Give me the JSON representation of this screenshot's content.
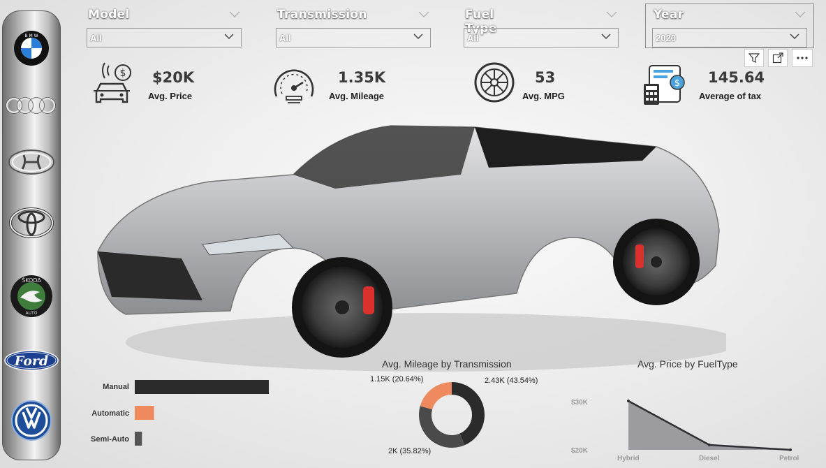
{
  "brands": [
    {
      "name": "BMW",
      "icon": "bmw-logo"
    },
    {
      "name": "Audi",
      "icon": "audi-logo"
    },
    {
      "name": "Hyundai",
      "icon": "hyundai-logo"
    },
    {
      "name": "Toyota",
      "icon": "toyota-logo"
    },
    {
      "name": "Skoda",
      "icon": "skoda-logo"
    },
    {
      "name": "Ford",
      "icon": "ford-logo"
    },
    {
      "name": "Volkswagen",
      "icon": "vw-logo"
    }
  ],
  "bmw_text": "B M W",
  "skoda_text": "ŠKODA",
  "skoda_auto": "AUTO",
  "ford_text": "Ford",
  "filters": {
    "model": {
      "title": "Model",
      "value": "All"
    },
    "transmission": {
      "title": "Transmission",
      "value": "All"
    },
    "fuel": {
      "title": "Fuel Type",
      "value": "All"
    },
    "year": {
      "title": "Year",
      "value": "2020"
    }
  },
  "kpis": {
    "price": {
      "value": "$20K",
      "label": "Avg. Price",
      "icon": "car-price-icon"
    },
    "mileage": {
      "value": "1.35K",
      "label": "Avg. Mileage",
      "icon": "speedometer-icon"
    },
    "mpg": {
      "value": "53",
      "label": "Avg. MPG",
      "icon": "tire-icon"
    },
    "tax": {
      "value": "145.64",
      "label": "Average of tax",
      "icon": "tax-calculator-icon"
    }
  },
  "toolbar": [
    "filter-icon",
    "focus-mode-icon",
    "more-options-icon"
  ],
  "charts": {
    "transmission_bar": {
      "categories": [
        "Manual",
        "Automatic",
        "Semi-Auto"
      ],
      "colors": [
        "#2b2b2b",
        "#ef8a5e",
        "#555555"
      ]
    },
    "mileage_donut": {
      "title": "Avg. Mileage by Transmission",
      "labels": [
        "2.43K (43.54%)",
        "2K (35.82%)",
        "1.15K (20.64%)"
      ]
    },
    "price_area": {
      "title": "Avg. Price by FuelType",
      "y_ticks": [
        "$30K",
        "$20K"
      ],
      "x_ticks": [
        "Hybrid",
        "Diesel",
        "Petrol"
      ]
    }
  },
  "chart_data": [
    {
      "type": "bar",
      "orientation": "horizontal",
      "title": "",
      "categories": [
        "Manual",
        "Automatic",
        "Semi-Auto"
      ],
      "values": [
        2.43,
        0.35,
        0.13
      ],
      "colors": [
        "#2b2b2b",
        "#ef8a5e",
        "#555555"
      ]
    },
    {
      "type": "pie",
      "donut": true,
      "title": "Avg. Mileage by Transmission",
      "categories": [
        "Manual",
        "Automatic",
        "Semi-Auto"
      ],
      "values": [
        2430,
        2000,
        1150
      ],
      "percent": [
        43.54,
        35.82,
        20.64
      ],
      "colors": [
        "#2b2b2b",
        "#4a4a4a",
        "#ef8a5e"
      ]
    },
    {
      "type": "area",
      "title": "Avg. Price by FuelType",
      "categories": [
        "Hybrid",
        "Diesel",
        "Petrol"
      ],
      "values": [
        30000,
        21000,
        20000
      ],
      "ylim": [
        20000,
        30000
      ],
      "y_ticks": [
        "$30K",
        "$20K"
      ]
    }
  ]
}
